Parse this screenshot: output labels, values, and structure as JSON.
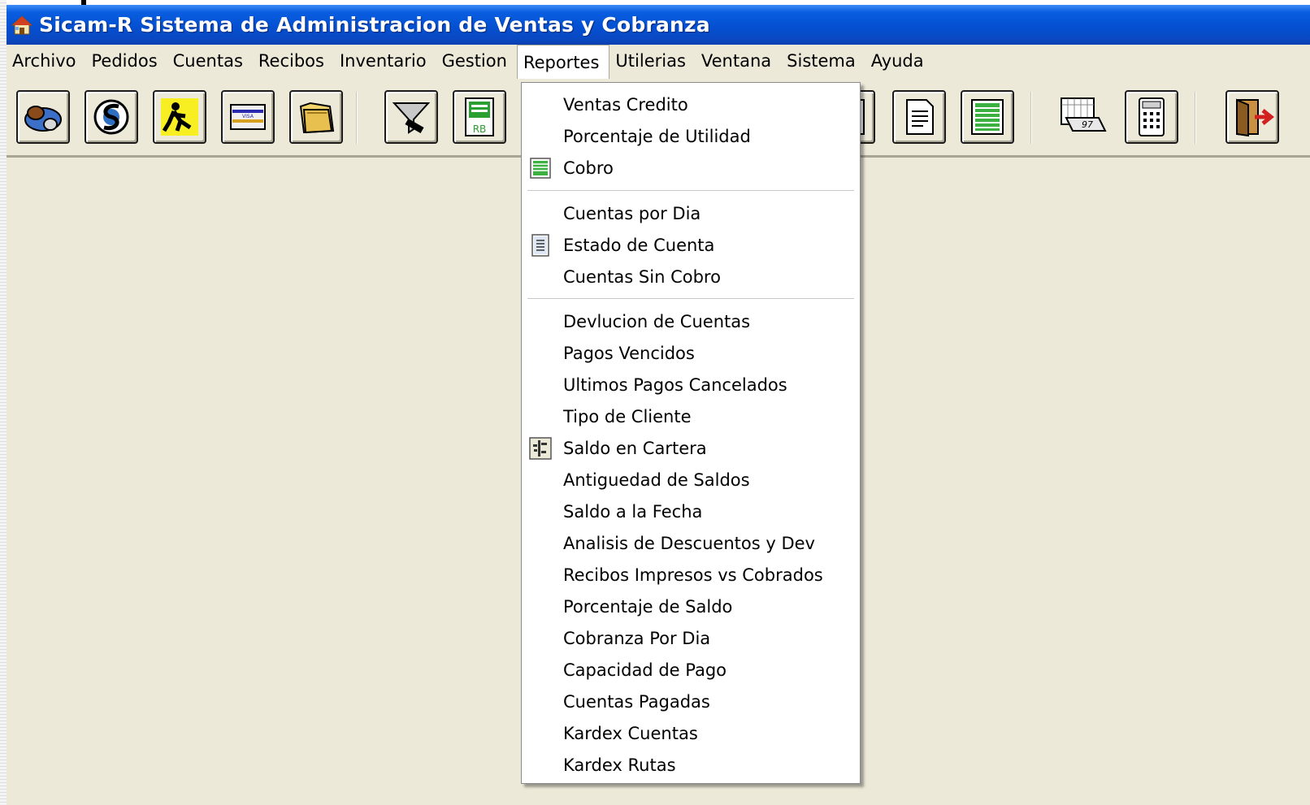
{
  "window": {
    "title": "Sicam-R  Sistema de Administracion de Ventas y Cobranza"
  },
  "menubar": {
    "items": [
      {
        "label": "Archivo"
      },
      {
        "label": "Pedidos"
      },
      {
        "label": "Cuentas"
      },
      {
        "label": "Recibos"
      },
      {
        "label": "Inventario"
      },
      {
        "label": "Gestion"
      },
      {
        "label": "Reportes",
        "open": true
      },
      {
        "label": "Utilerias"
      },
      {
        "label": "Ventana"
      },
      {
        "label": "Sistema"
      },
      {
        "label": "Ayuda"
      }
    ]
  },
  "toolbar": {
    "buttons": [
      {
        "icon": "handshake-icon"
      },
      {
        "icon": "globe-money-icon"
      },
      {
        "icon": "worker-icon"
      },
      {
        "icon": "visa-card-icon"
      },
      {
        "icon": "folders-icon"
      },
      {
        "icon": "funnel-icon"
      },
      {
        "icon": "rb-report-icon"
      },
      {
        "icon": "half-report-icon"
      },
      {
        "icon": "document-icon"
      },
      {
        "icon": "green-report-icon"
      },
      {
        "icon": "calendar-97-icon"
      },
      {
        "icon": "calculator-icon"
      },
      {
        "icon": "exit-door-icon"
      }
    ]
  },
  "reportes_menu": {
    "items": [
      {
        "label": "Ventas Credito"
      },
      {
        "label": "Porcentaje de Utilidad"
      },
      {
        "label": "Cobro",
        "icon": "green-list-icon"
      },
      {
        "label": "Cuentas por Dia"
      },
      {
        "label": "Estado de Cuenta",
        "icon": "statement-icon"
      },
      {
        "label": "Cuentas Sin Cobro"
      },
      {
        "label": "Devlucion de Cuentas"
      },
      {
        "label": "Pagos Vencidos"
      },
      {
        "label": "Ultimos Pagos Cancelados"
      },
      {
        "label": "Tipo de Cliente"
      },
      {
        "label": "Saldo en Cartera",
        "icon": "portfolio-icon"
      },
      {
        "label": "Antiguedad de Saldos"
      },
      {
        "label": "Saldo a la Fecha"
      },
      {
        "label": "Analisis de Descuentos y Dev"
      },
      {
        "label": "Recibos Impresos vs Cobrados"
      },
      {
        "label": "Porcentaje de Saldo"
      },
      {
        "label": "Cobranza Por Dia"
      },
      {
        "label": "Capacidad de Pago"
      },
      {
        "label": "Cuentas Pagadas"
      },
      {
        "label": "Kardex Cuentas"
      },
      {
        "label": "Kardex Rutas"
      }
    ]
  }
}
